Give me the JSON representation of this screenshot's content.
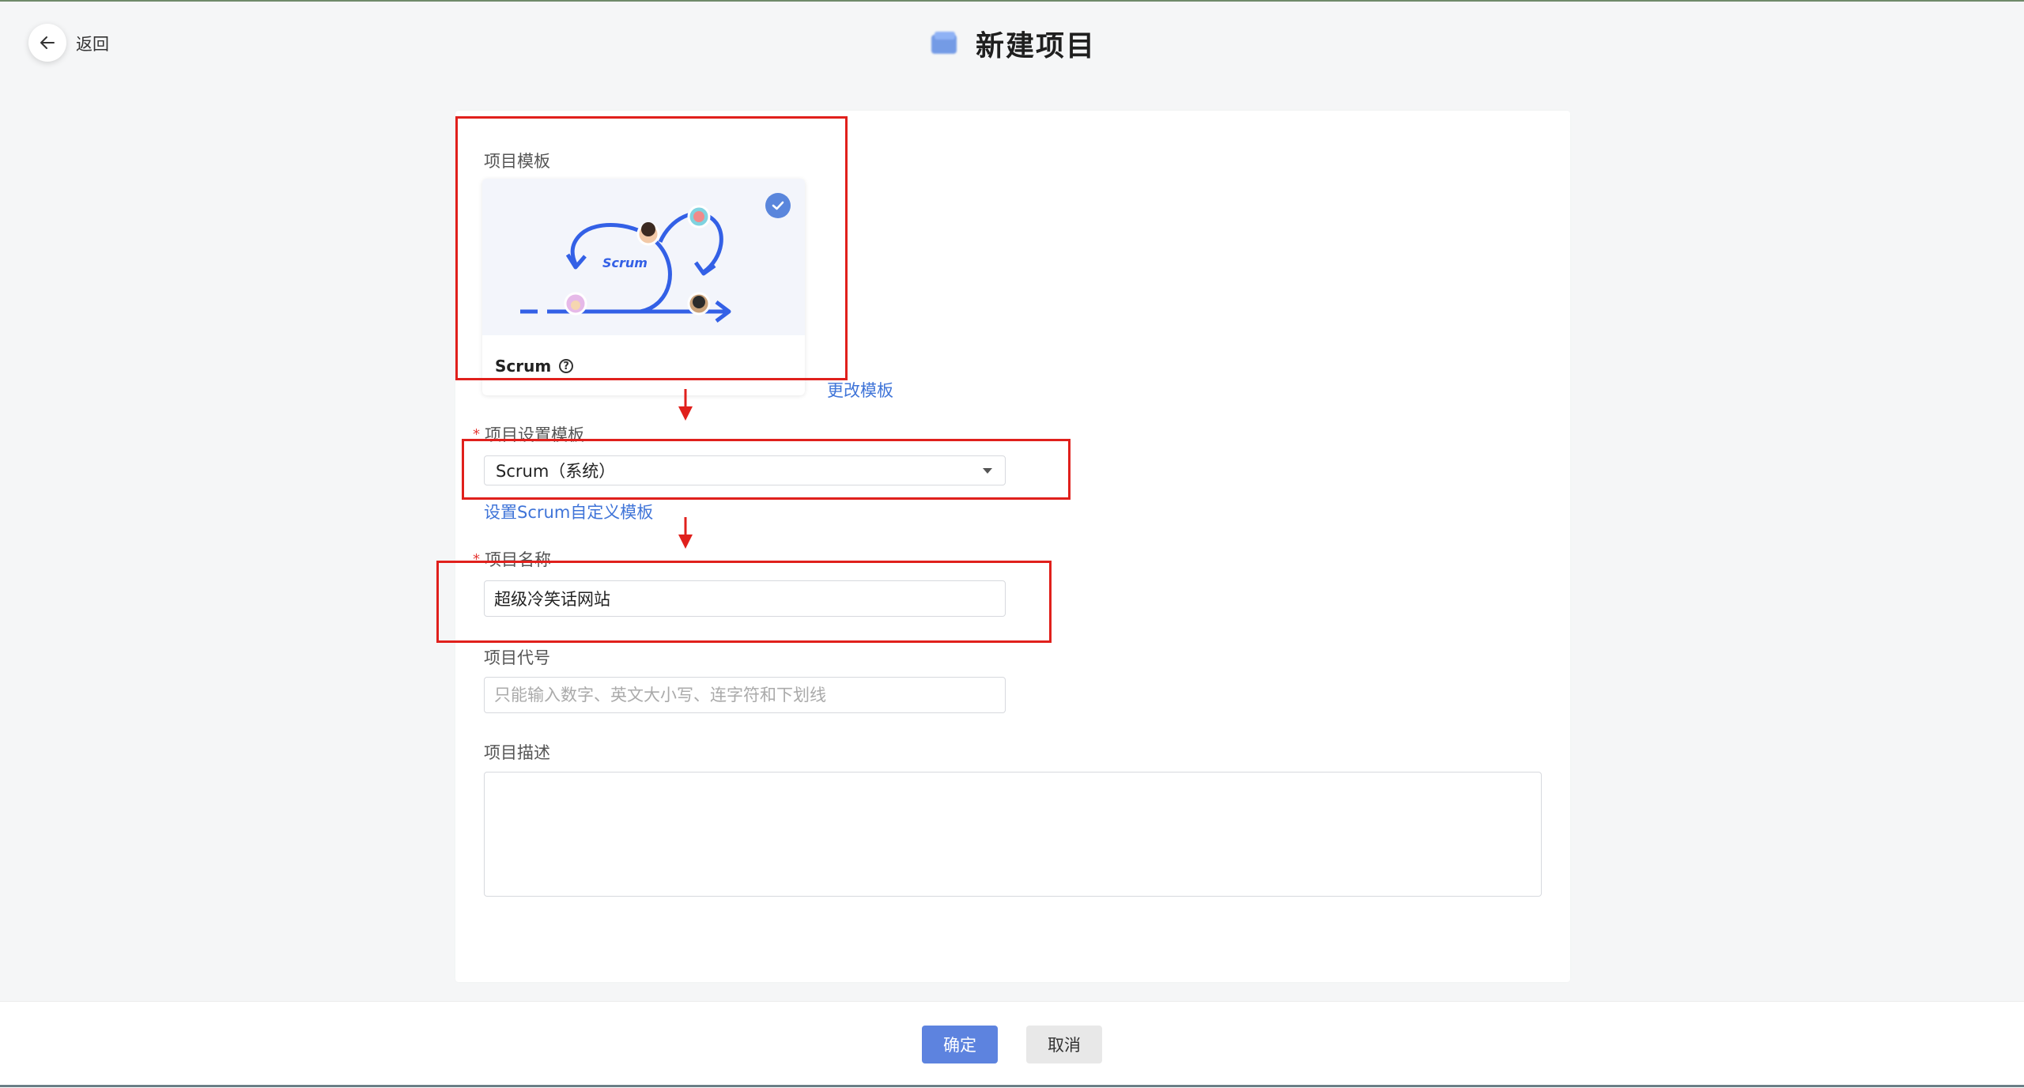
{
  "header": {
    "back_label": "返回",
    "title": "新建项目"
  },
  "form": {
    "template_label": "项目模板",
    "template_card": {
      "image_text": "Scrum",
      "name": "Scrum",
      "selected": true
    },
    "change_template_link": "更改模板",
    "settings_template_label": "项目设置模板",
    "settings_template_value": "Scrum（系统）",
    "custom_template_link": "设置Scrum自定义模板",
    "project_name_label": "项目名称",
    "project_name_value": "超级冷笑话网站",
    "project_code_label": "项目代号",
    "project_code_placeholder": "只能输入数字、英文大小写、连字符和下划线",
    "project_desc_label": "项目描述",
    "required_mark": "*"
  },
  "footer": {
    "confirm_label": "确定",
    "cancel_label": "取消"
  },
  "colors": {
    "accent": "#5d83df",
    "link": "#3f74d8",
    "annotation": "#e0201c",
    "page_bg": "#f5f6f7"
  },
  "icons": {
    "back": "arrow-left-icon",
    "project": "project-icon",
    "help": "question-circle-icon",
    "check": "check-circle-icon",
    "caret": "caret-down-icon"
  }
}
